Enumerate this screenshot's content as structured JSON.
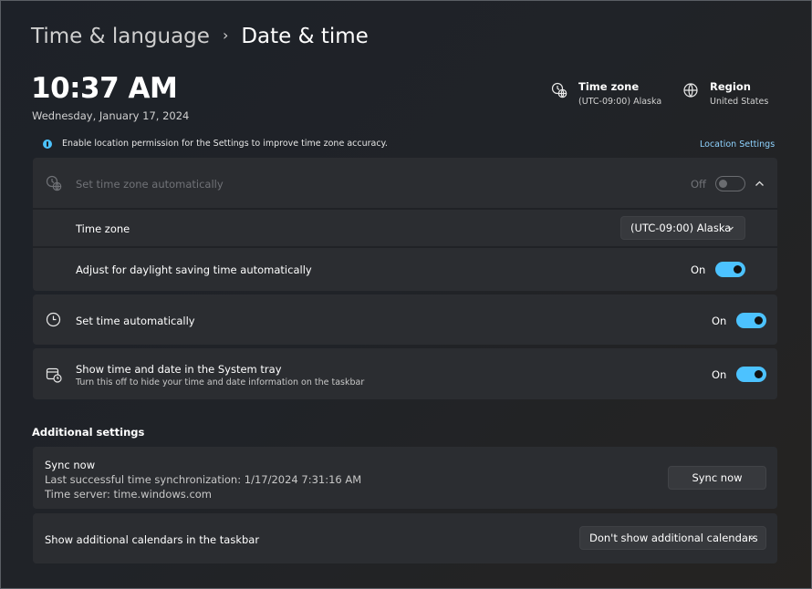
{
  "breadcrumb": {
    "parent": "Time & language",
    "separator": "›",
    "current": "Date & time"
  },
  "clock": {
    "time": "10:37 AM",
    "date": "Wednesday, January 17, 2024"
  },
  "header_info": {
    "time_zone": {
      "icon": "time-zone-icon",
      "label": "Time zone",
      "value": "(UTC-09:00) Alaska"
    },
    "region": {
      "icon": "globe-icon",
      "label": "Region",
      "value": "United States"
    }
  },
  "notice": {
    "icon": "info-icon",
    "text": "Enable location permission for the Settings to improve time zone accuracy.",
    "link": "Location Settings"
  },
  "auto_timezone": {
    "icon": "time-zone-icon",
    "label": "Set time zone automatically",
    "state_label": "Off",
    "expanded": true,
    "time_zone_row": {
      "label": "Time zone",
      "selected": "(UTC-09:00) Alaska"
    },
    "dst_row": {
      "label": "Adjust for daylight saving time automatically",
      "state_label": "On"
    }
  },
  "set_time_auto": {
    "icon": "clock-icon",
    "label": "Set time automatically",
    "state_label": "On"
  },
  "system_tray": {
    "icon": "calendar-clock-icon",
    "label": "Show time and date in the System tray",
    "description": "Turn this off to hide your time and date information on the taskbar",
    "state_label": "On"
  },
  "additional": {
    "title": "Additional settings",
    "sync": {
      "label": "Sync now",
      "last_sync": "Last successful time synchronization: 1/17/2024 7:31:16 AM",
      "server": "Time server: time.windows.com",
      "button": "Sync now"
    },
    "calendars": {
      "label": "Show additional calendars in the taskbar",
      "selected": "Don't show additional calendars"
    }
  },
  "colors": {
    "accent": "#4cc2ff",
    "card": "#2b2d31",
    "background": "#1e2126"
  }
}
